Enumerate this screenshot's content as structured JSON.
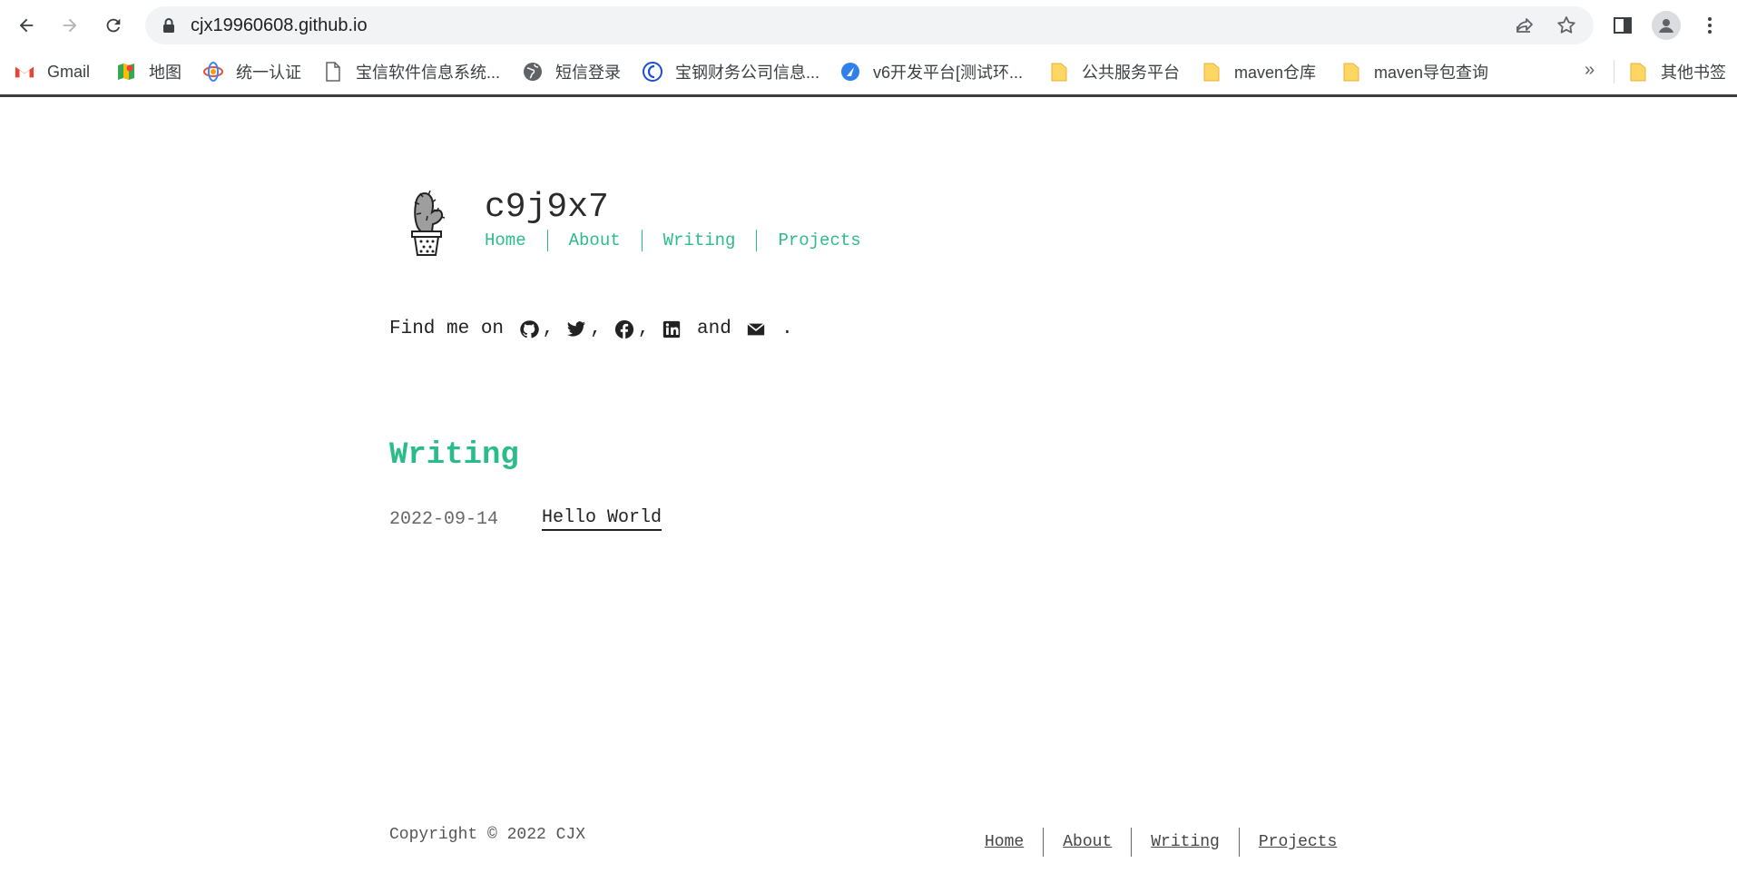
{
  "browser": {
    "url": "cjx19960608.github.io",
    "bookmarks": [
      {
        "label": "Gmail",
        "icon": "gmail-icon"
      },
      {
        "label": "地图",
        "icon": "maps-icon"
      },
      {
        "label": "统一认证",
        "icon": "auth-icon"
      },
      {
        "label": "宝信软件信息系统...",
        "icon": "page-icon"
      },
      {
        "label": "短信登录",
        "icon": "globe-icon"
      },
      {
        "label": "宝钢财务公司信息...",
        "icon": "baogang-icon"
      },
      {
        "label": "v6开发平台[测试环...",
        "icon": "v6-icon"
      },
      {
        "label": "公共服务平台",
        "icon": "folder-icon"
      },
      {
        "label": "maven仓库",
        "icon": "folder-icon"
      },
      {
        "label": "maven导包查询",
        "icon": "folder-icon"
      }
    ],
    "more_label": "»",
    "other_bookmarks": "其他书签"
  },
  "site": {
    "title": "c9j9x7",
    "nav": [
      "Home",
      "About",
      "Writing",
      "Projects"
    ],
    "findme_prefix": "Find me on ",
    "findme_and": " and ",
    "findme_end": " .",
    "comma": ",",
    "accent": "#2bbc8a"
  },
  "writing": {
    "title": "Writing",
    "posts": [
      {
        "date": "2022-09-14",
        "title": "Hello World"
      }
    ]
  },
  "footer": {
    "copyright": "Copyright © 2022 CJX",
    "nav": [
      "Home",
      "About",
      "Writing",
      "Projects"
    ]
  }
}
